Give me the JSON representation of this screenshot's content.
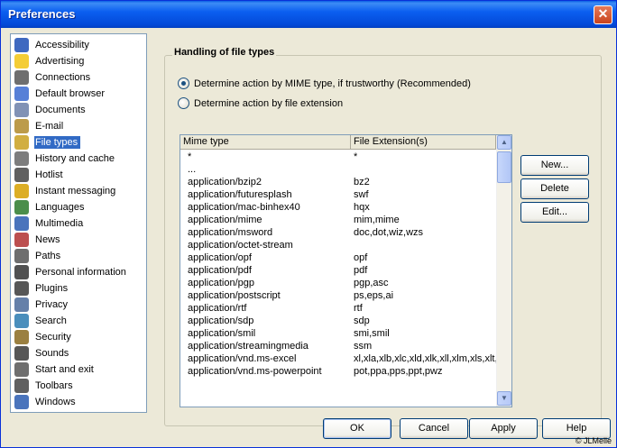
{
  "window": {
    "title": "Preferences",
    "close_glyph": "✕"
  },
  "sidebar": {
    "items": [
      {
        "label": "Accessibility",
        "icon": "accessibility-icon"
      },
      {
        "label": "Advertising",
        "icon": "smiley-icon"
      },
      {
        "label": "Connections",
        "icon": "plug-icon"
      },
      {
        "label": "Default browser",
        "icon": "document-icon"
      },
      {
        "label": "Documents",
        "icon": "documents-icon"
      },
      {
        "label": "E-mail",
        "icon": "envelope-icon"
      },
      {
        "label": "File types",
        "icon": "file-types-icon",
        "selected": true
      },
      {
        "label": "History and cache",
        "icon": "history-icon"
      },
      {
        "label": "Hotlist",
        "icon": "hotlist-icon"
      },
      {
        "label": "Instant messaging",
        "icon": "lightning-icon"
      },
      {
        "label": "Languages",
        "icon": "languages-icon"
      },
      {
        "label": "Multimedia",
        "icon": "multimedia-icon"
      },
      {
        "label": "News",
        "icon": "news-icon"
      },
      {
        "label": "Paths",
        "icon": "paths-icon"
      },
      {
        "label": "Personal information",
        "icon": "person-icon"
      },
      {
        "label": "Plugins",
        "icon": "plugins-icon"
      },
      {
        "label": "Privacy",
        "icon": "privacy-icon"
      },
      {
        "label": "Search",
        "icon": "search-icon"
      },
      {
        "label": "Security",
        "icon": "keys-icon"
      },
      {
        "label": "Sounds",
        "icon": "speaker-icon"
      },
      {
        "label": "Start and exit",
        "icon": "start-exit-icon"
      },
      {
        "label": "Toolbars",
        "icon": "toolbars-icon"
      },
      {
        "label": "Windows",
        "icon": "windows-icon"
      }
    ]
  },
  "group": {
    "title": "Handling of file types",
    "radio_mime": "Determine action by MIME type, if trustworthy (Recommended)",
    "radio_ext": "Determine action by file extension",
    "selected": "mime"
  },
  "table": {
    "headers": [
      "Mime type",
      "File Extension(s)"
    ],
    "rows": [
      [
        "*",
        "*"
      ],
      [
        "...",
        ""
      ],
      [
        "application/bzip2",
        "bz2"
      ],
      [
        "application/futuresplash",
        "swf"
      ],
      [
        "application/mac-binhex40",
        "hqx"
      ],
      [
        "application/mime",
        "mim,mime"
      ],
      [
        "application/msword",
        "doc,dot,wiz,wzs"
      ],
      [
        "application/octet-stream",
        ""
      ],
      [
        "application/opf",
        "opf"
      ],
      [
        "application/pdf",
        "pdf"
      ],
      [
        "application/pgp",
        "pgp,asc"
      ],
      [
        "application/postscript",
        "ps,eps,ai"
      ],
      [
        "application/rtf",
        "rtf"
      ],
      [
        "application/sdp",
        "sdp"
      ],
      [
        "application/smil",
        "smi,smil"
      ],
      [
        "application/streamingmedia",
        "ssm"
      ],
      [
        "application/vnd.ms-excel",
        "xl,xla,xlb,xlc,xld,xlk,xll,xlm,xls,xlt,xlv"
      ],
      [
        "application/vnd.ms-powerpoint",
        "pot,ppa,pps,ppt,pwz"
      ]
    ]
  },
  "side_buttons": {
    "new": "New...",
    "delete": "Delete",
    "edit": "Edit..."
  },
  "footer": {
    "ok": "OK",
    "cancel": "Cancel",
    "apply": "Apply",
    "help": "Help",
    "copyright": "© JLMelle"
  },
  "colors": {
    "selection": "#316ac5",
    "titlebar": "#0b5ff0",
    "dialog": "#ece9d8"
  }
}
